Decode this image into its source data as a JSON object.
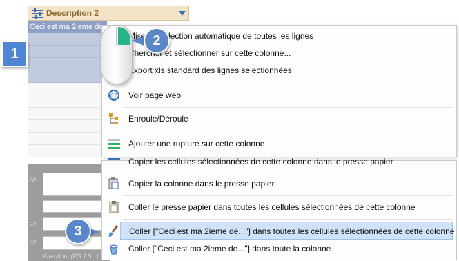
{
  "column": {
    "header": "Description 2",
    "first_cell": "Ceci est ma 2ieme description"
  },
  "grid": {
    "row_numbers": [
      "28",
      "32",
      "32"
    ],
    "note": "Attention. (PS 1.5...) Ter..."
  },
  "menu": {
    "items": [
      {
        "label": "Mise en sélection automatique de toutes les lignes",
        "icon": "select-all-icon"
      },
      {
        "label": "Chercher et sélectionner sur cette colonne...",
        "icon": "search-icon"
      },
      {
        "label": "Export xls standard des lignes sélectionnées",
        "icon": "excel-icon"
      },
      {
        "label": "Voir page web",
        "icon": "web-icon"
      },
      {
        "label": "Enroule/Déroule",
        "icon": "tree-icon"
      },
      {
        "label": "Ajouter une rupture sur cette colonne",
        "icon": "group-break-icon"
      },
      {
        "label": "Copier les cellules sélectionnées de cette colonne dans le presse papier",
        "icon": "copy-cells-icon"
      },
      {
        "label": "Copier la colonne dans le presse papier",
        "icon": "copy-column-icon"
      },
      {
        "label": "Coller le presse papier dans toutes les cellules sélectionnées de cette colonne",
        "icon": "paste-icon"
      },
      {
        "label": "Coller [\"Ceci est ma 2ieme de...\"] dans toutes les cellules sélectionnées de cette colonne",
        "icon": "brush-icon"
      },
      {
        "label": "Coller [\"Ceci est ma 2ieme de...\"] dans toute la colonne",
        "icon": "bucket-icon"
      }
    ]
  },
  "callouts": {
    "one": "1",
    "two": "2",
    "three": "3"
  },
  "colors": {
    "highlight": "#cfe2f8",
    "callout": "#5b87c8",
    "selected_row": "#c3cbe0"
  }
}
